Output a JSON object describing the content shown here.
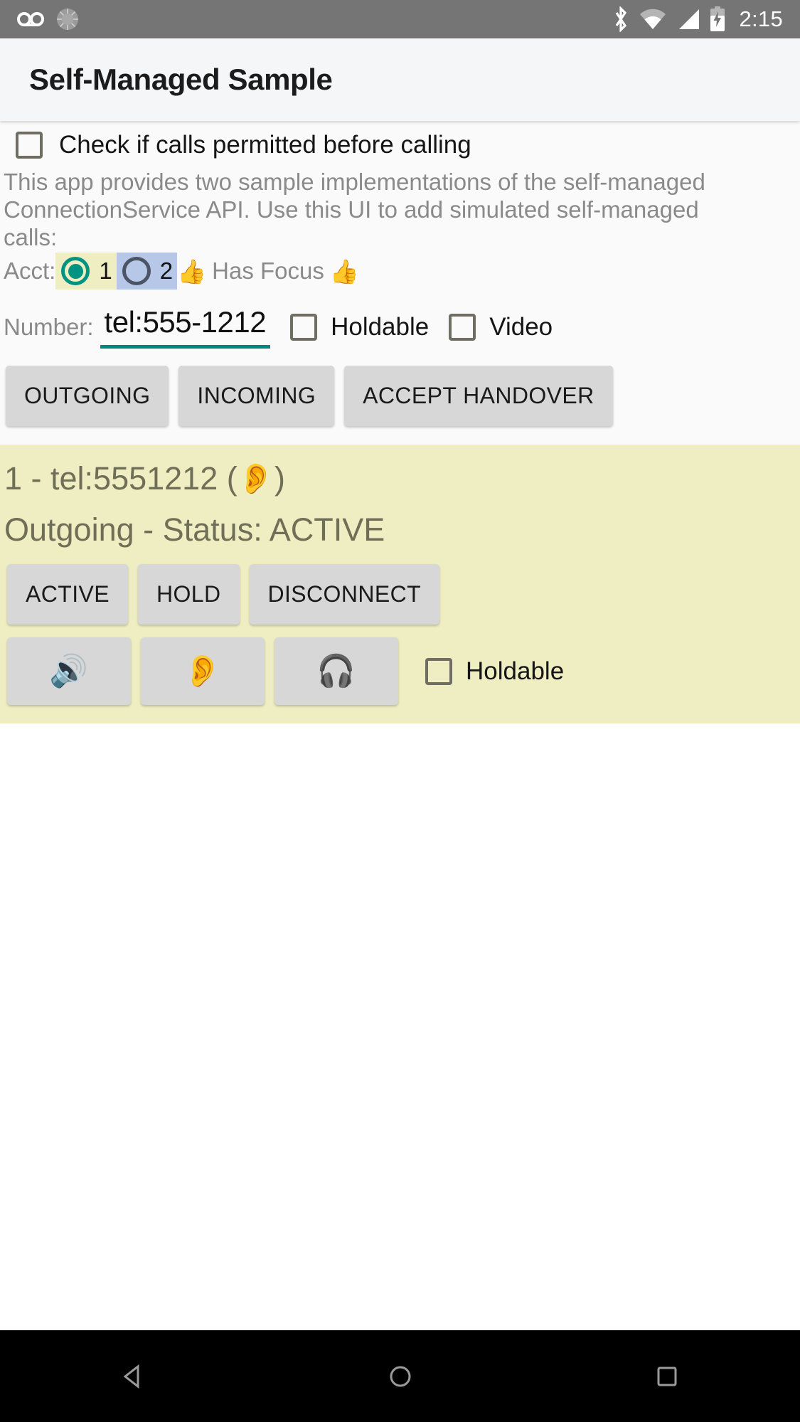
{
  "status_bar": {
    "icons": [
      "voicemail-icon",
      "sync-icon",
      "bluetooth-icon",
      "wifi-icon",
      "cell-signal-icon",
      "battery-charging-icon"
    ],
    "time": "2:15",
    "background_color": "#757575"
  },
  "app_bar": {
    "title": "Self-Managed Sample",
    "background_color": "#f5f6f7"
  },
  "settings": {
    "check_permitted": {
      "label": "Check if calls permitted before calling",
      "checked": false
    }
  },
  "description": "This app provides two sample implementations of the self-managed ConnectionService API.  Use this UI to add simulated self-managed calls:",
  "account_row": {
    "label": "Acct:",
    "options": [
      {
        "value": "1",
        "selected": true,
        "highlight_color": "#efeec2",
        "accent_color": "#009382"
      },
      {
        "value": "2",
        "selected": false,
        "highlight_color": "#b6c7e8",
        "accent_color": "#4b5565"
      }
    ],
    "focus_text": "Has Focus",
    "focus_emoji_left": "👍",
    "focus_emoji_right": "👍"
  },
  "number_row": {
    "label": "Number:",
    "value": "tel:555-1212",
    "placeholder": "tel:555-1212",
    "underline_color": "#00897b",
    "holdable": {
      "label": "Holdable",
      "checked": false
    },
    "video": {
      "label": "Video",
      "checked": false
    }
  },
  "action_buttons": [
    {
      "label": "OUTGOING",
      "name": "outgoing-button"
    },
    {
      "label": "INCOMING",
      "name": "incoming-button"
    },
    {
      "label": "ACCEPT HANDOVER",
      "name": "accept-handover-button"
    }
  ],
  "call_card": {
    "background_color": "#efeec2",
    "text_color": "#6f6f58",
    "title_prefix": "1 - tel:5551212 ( ",
    "title_emoji": "👂",
    "title_suffix": " )",
    "status_line": "Outgoing - Status: ACTIVE",
    "controls": [
      {
        "label": "ACTIVE",
        "name": "call-active-button"
      },
      {
        "label": "HOLD",
        "name": "call-hold-button"
      },
      {
        "label": "DISCONNECT",
        "name": "call-disconnect-button"
      }
    ],
    "audio_routes": [
      {
        "emoji": "🔊",
        "name": "audio-speaker-button"
      },
      {
        "emoji": "👂",
        "name": "audio-earpiece-button"
      },
      {
        "emoji": "🎧",
        "name": "audio-headset-button"
      }
    ],
    "holdable": {
      "label": "Holdable",
      "checked": false
    }
  },
  "nav_bar": {
    "back_label": "back-button",
    "home_label": "home-button",
    "recents_label": "recents-button",
    "background_color": "#000000"
  }
}
